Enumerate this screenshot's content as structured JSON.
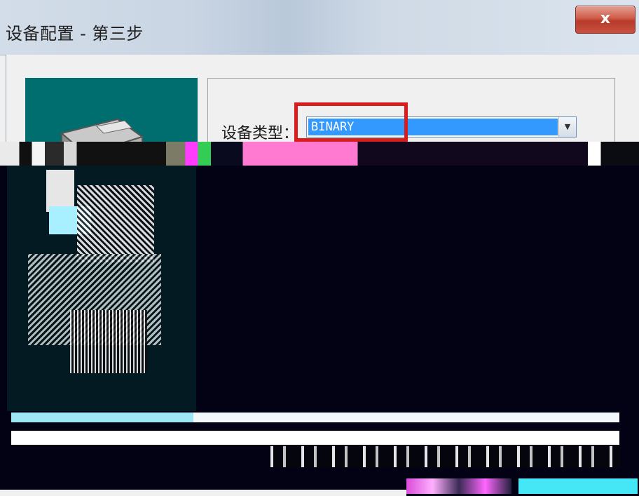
{
  "window": {
    "title": "设备配置 - 第三步",
    "close_label": "x"
  },
  "form": {
    "device_type_label": "设备类型：",
    "device_type_value": "BINARY"
  },
  "icons": {
    "device": "printer-device-icon",
    "dropdown": "chevron-down-icon"
  },
  "colors": {
    "side_panel": "#006e6e",
    "selection": "#3399ff",
    "highlight": "#d91d1d",
    "close_button": "#c8503f"
  }
}
